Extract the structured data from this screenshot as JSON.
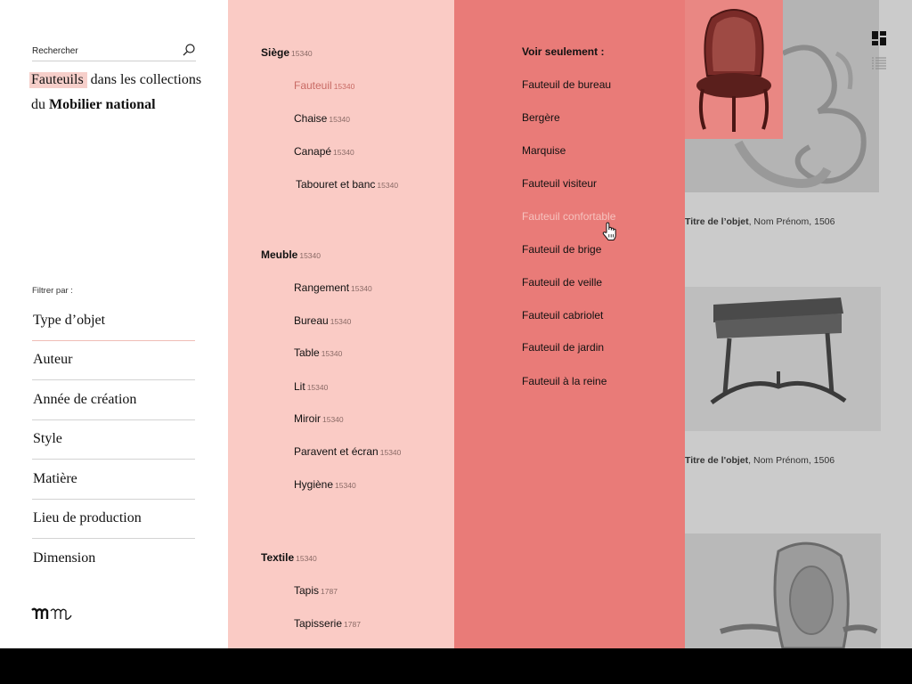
{
  "search": {
    "placeholder": "Rechercher"
  },
  "title": {
    "highlight": "Fauteuils",
    "middle": "dans les collections du",
    "bold1": "Mobilier",
    "bold2": "national"
  },
  "filters": {
    "label": "Filtrer par :",
    "items": [
      {
        "label": "Type d’objet"
      },
      {
        "label": "Auteur"
      },
      {
        "label": "Année de création"
      },
      {
        "label": "Style"
      },
      {
        "label": "Matière"
      },
      {
        "label": "Lieu de production"
      },
      {
        "label": "Dimension"
      }
    ]
  },
  "categories": {
    "siege": {
      "label": "Siège",
      "count": "15340",
      "items": [
        {
          "label": "Fauteuil",
          "count": "15340"
        },
        {
          "label": "Chaise",
          "count": "15340"
        },
        {
          "label": "Canapé",
          "count": "15340"
        },
        {
          "label": "Tabouret et banc",
          "count": "15340"
        }
      ]
    },
    "meuble": {
      "label": "Meuble",
      "count": "15340",
      "items": [
        {
          "label": "Rangement",
          "count": "15340"
        },
        {
          "label": "Bureau",
          "count": "15340"
        },
        {
          "label": "Table",
          "count": "15340"
        },
        {
          "label": "Lit",
          "count": "15340"
        },
        {
          "label": "Miroir",
          "count": "15340"
        },
        {
          "label": "Paravent et écran",
          "count": "15340"
        },
        {
          "label": "Hygiène",
          "count": "15340"
        }
      ]
    },
    "textile": {
      "label": "Textile",
      "count": "15340",
      "items": [
        {
          "label": "Tapis",
          "count": "1787"
        },
        {
          "label": "Tapisserie",
          "count": "1787"
        }
      ]
    }
  },
  "refine": {
    "heading": "Voir seulement :",
    "options": [
      {
        "label": "Fauteuil de bureau"
      },
      {
        "label": "Bergère"
      },
      {
        "label": "Marquise"
      },
      {
        "label": "Fauteuil visiteur"
      },
      {
        "label": "Fauteuil confortable"
      },
      {
        "label": "Fauteuil de brige"
      },
      {
        "label": "Fauteuil de veille"
      },
      {
        "label": "Fauteuil cabriolet"
      },
      {
        "label": "Fauteuil de jardin"
      },
      {
        "label": "Fauteuil à la reine"
      }
    ]
  },
  "gallery": {
    "items": [
      {
        "title": "Titre de l’objet",
        "meta": ", Nom Prénom, 1506"
      },
      {
        "title": "Titre de l'objet",
        "meta": ", Nom Prénom, 1506"
      }
    ]
  },
  "colors": {
    "panel_light": "#facbc5",
    "panel_coral": "#e97b78",
    "accent": "#c86a64",
    "highlight": "#f6cfca"
  },
  "icons": [
    "search-icon",
    "grid-view-icon",
    "list-view-icon",
    "hand-pointer-cursor-icon",
    "mobilier-national-logo"
  ]
}
